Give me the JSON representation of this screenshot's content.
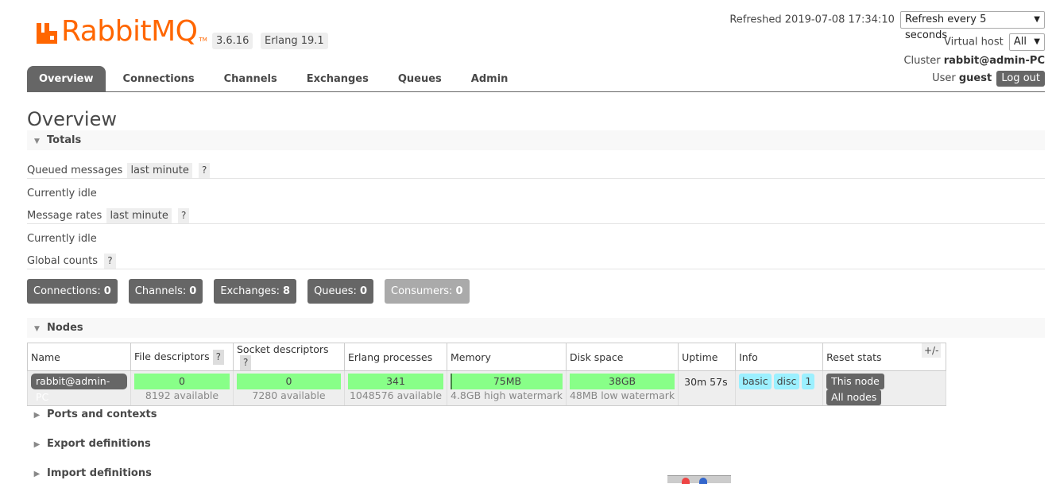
{
  "app": {
    "logo_text": "RabbitMQ",
    "logo_tm": "TM",
    "version": "3.6.16",
    "erlang": "Erlang 19.1",
    "brand_color": "#ff6600"
  },
  "header": {
    "refreshed_label": "Refreshed 2019-07-08 17:34:10",
    "refresh_select": "Refresh every 5 seconds",
    "vhost_label": "Virtual host",
    "vhost_value": "All",
    "cluster_label": "Cluster",
    "cluster_value": "rabbit@admin-PC",
    "user_label": "User",
    "user_value": "guest",
    "logout_label": "Log out"
  },
  "tabs": [
    {
      "label": "Overview",
      "active": true
    },
    {
      "label": "Connections"
    },
    {
      "label": "Channels"
    },
    {
      "label": "Exchanges"
    },
    {
      "label": "Queues"
    },
    {
      "label": "Admin"
    }
  ],
  "page_title": "Overview",
  "totals": {
    "title": "Totals",
    "queued_label": "Queued messages",
    "queued_range": "last minute",
    "queued_state": "Currently idle",
    "rates_label": "Message rates",
    "rates_range": "last minute",
    "rates_state": "Currently idle",
    "global_label": "Global counts",
    "help": "?",
    "counts": [
      {
        "label": "Connections:",
        "value": "0"
      },
      {
        "label": "Channels:",
        "value": "0"
      },
      {
        "label": "Exchanges:",
        "value": "8"
      },
      {
        "label": "Queues:",
        "value": "0"
      },
      {
        "label": "Consumers:",
        "value": "0",
        "disabled": true
      }
    ]
  },
  "nodes": {
    "title": "Nodes",
    "toggle": "+/-",
    "columns": [
      "Name",
      "File descriptors",
      "Socket descriptors",
      "Erlang processes",
      "Memory",
      "Disk space",
      "Uptime",
      "Info",
      "Reset stats"
    ],
    "row": {
      "name": "rabbit@admin-PC",
      "fd_used": "0",
      "fd_available": "8192 available",
      "sd_used": "0",
      "sd_available": "7280 available",
      "erl_used": "341",
      "erl_available": "1048576 available",
      "memory": "75MB",
      "memory_note": "4.8GB high watermark",
      "disk": "38GB",
      "disk_note": "48MB low watermark",
      "uptime": "30m 57s",
      "info": [
        "basic",
        "disc",
        "1"
      ],
      "reset_this": "This node",
      "reset_all": "All nodes"
    }
  },
  "sections": {
    "ports": "Ports and contexts",
    "export": "Export definitions",
    "import": "Import definitions"
  }
}
